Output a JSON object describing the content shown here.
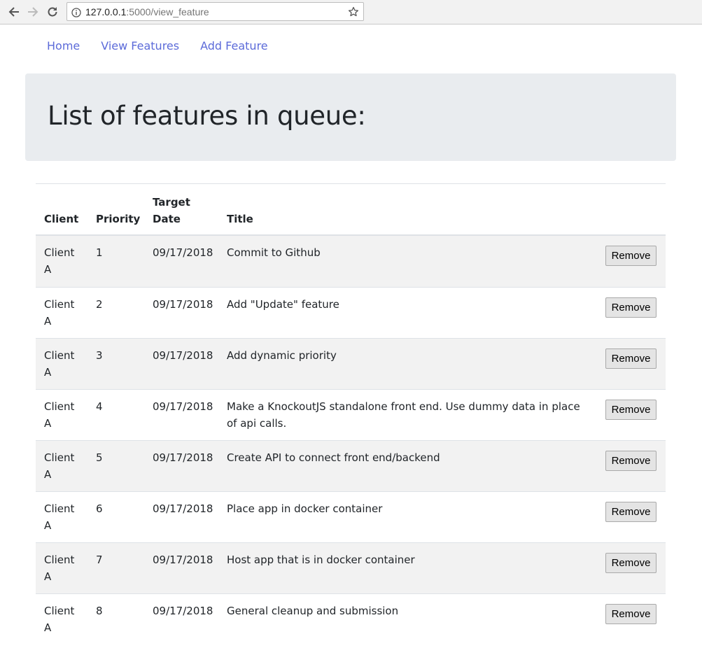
{
  "browser": {
    "url_host": "127.0.0.1",
    "url_path": ":5000/view_feature"
  },
  "nav": {
    "items": [
      {
        "label": "Home"
      },
      {
        "label": "View Features"
      },
      {
        "label": "Add Feature"
      }
    ]
  },
  "header": {
    "title": "List of features in queue:"
  },
  "table": {
    "headers": {
      "client": "Client",
      "priority": "Priority",
      "target_date_line1": "Target",
      "target_date_line2": "Date",
      "title": "Title"
    },
    "remove_label": "Remove",
    "rows": [
      {
        "client": "Client A",
        "priority": "1",
        "date": "09/17/2018",
        "title": "Commit to Github"
      },
      {
        "client": "Client A",
        "priority": "2",
        "date": "09/17/2018",
        "title": "Add \"Update\" feature"
      },
      {
        "client": "Client A",
        "priority": "3",
        "date": "09/17/2018",
        "title": "Add dynamic priority"
      },
      {
        "client": "Client A",
        "priority": "4",
        "date": "09/17/2018",
        "title": "Make a KnockoutJS standalone front end. Use dummy data in place of api calls."
      },
      {
        "client": "Client A",
        "priority": "5",
        "date": "09/17/2018",
        "title": "Create API to connect front end/backend"
      },
      {
        "client": "Client A",
        "priority": "6",
        "date": "09/17/2018",
        "title": "Place app in docker container"
      },
      {
        "client": "Client A",
        "priority": "7",
        "date": "09/17/2018",
        "title": "Host app that is in docker container"
      },
      {
        "client": "Client A",
        "priority": "8",
        "date": "09/17/2018",
        "title": "General cleanup and submission"
      }
    ]
  }
}
